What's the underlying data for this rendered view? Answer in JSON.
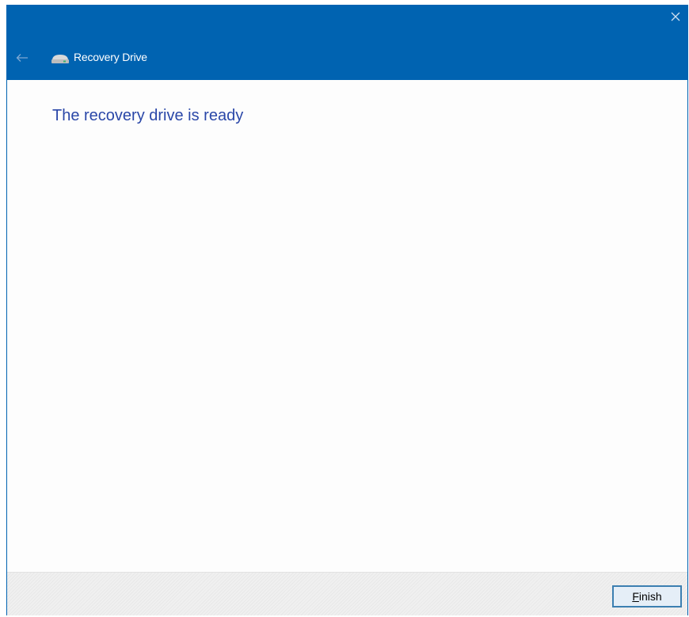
{
  "window": {
    "title": "Recovery Drive",
    "close_icon": "close-icon",
    "back_icon": "back-arrow-icon",
    "app_icon": "drive-icon"
  },
  "content": {
    "heading": "The recovery drive is ready"
  },
  "footer": {
    "finish_accel": "F",
    "finish_rest": "inish"
  },
  "colors": {
    "titlebar": "#0063b1",
    "heading": "#2a47a8",
    "button_border": "#3c7fb1"
  }
}
